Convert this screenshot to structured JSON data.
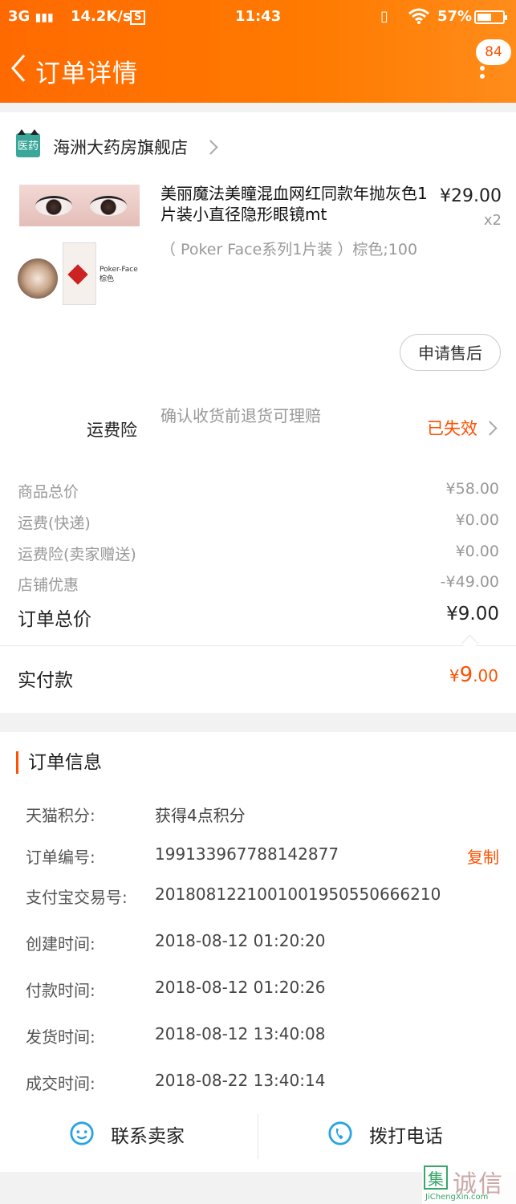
{
  "status_bar": {
    "network": "3G",
    "speed": "14.2K/s",
    "s_icon": "S",
    "time": "11:43",
    "battery": "57%",
    "battery_level": 0.57,
    "icons": [
      "signal-icon",
      "vibrate-icon",
      "wifi-icon",
      "battery-icon"
    ]
  },
  "header": {
    "title": "订单详情",
    "badge": "84",
    "back_icon": "chevron-left-icon",
    "more_icon": "more-vertical-icon"
  },
  "store": {
    "logo_text": "医药",
    "name": "海洲大药房旗舰店"
  },
  "product": {
    "title": "美丽魔法美瞳混血网红同款年抛灰色1片装小直径隐形眼镜mt",
    "price": "¥29.00",
    "quantity": "x2",
    "sku": "（ Poker Face系列1片装 ）棕色;100",
    "image_text": [
      "Poker-Face",
      "棕色"
    ]
  },
  "after_sale_button": "申请售后",
  "shipping_insurance": {
    "label": "运费险",
    "desc": "确认收货前退货可理赔",
    "status": "已失效"
  },
  "fees": [
    {
      "label": "商品总价",
      "value": "¥58.00"
    },
    {
      "label": "运费(快递)",
      "value": "¥0.00"
    },
    {
      "label": "运费险(卖家赠送)",
      "value": "¥0.00"
    },
    {
      "label": "店铺优惠",
      "value": "-¥49.00"
    },
    {
      "label": "订单总价",
      "value": "¥9.00"
    }
  ],
  "paid": {
    "label": "实付款",
    "currency": "¥",
    "integer": "9",
    "decimal": ".00"
  },
  "order_info": {
    "heading": "订单信息",
    "rows": [
      {
        "key": "天猫积分:",
        "value": "获得4点积分"
      },
      {
        "key": "订单编号:",
        "value": "199133967788142877"
      },
      {
        "key": "支付宝交易号:",
        "value": "2018081221001001950550666210"
      },
      {
        "key": "创建时间:",
        "value": "2018-08-12 01:20:20"
      },
      {
        "key": "付款时间:",
        "value": "2018-08-12 01:20:26"
      },
      {
        "key": "发货时间:",
        "value": "2018-08-12 13:40:08"
      },
      {
        "key": "成交时间:",
        "value": "2018-08-22 13:40:14"
      }
    ],
    "copy_label": "复制"
  },
  "actions": {
    "contact_seller": "联系卖家",
    "call": "拨打电话"
  },
  "watermark": {
    "icon": "集",
    "text": "诚信",
    "url": "JiChengXin.com"
  },
  "colors": {
    "brand_orange": "#ff5000",
    "header_gradient_start": "#ff6a00",
    "action_blue": "#2aa3e6"
  }
}
